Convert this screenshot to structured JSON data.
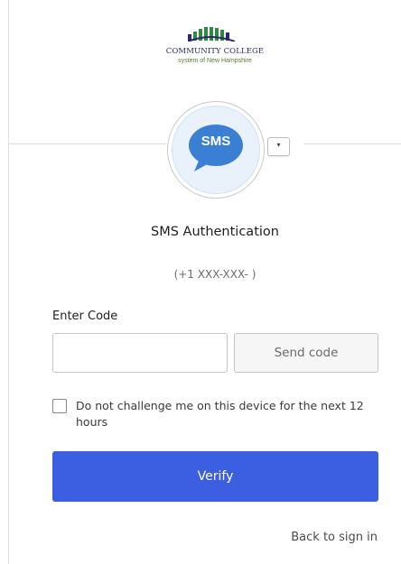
{
  "logo": {
    "name": "COMMUNITY COLLEGE",
    "subtitle": "system of New Hampshire",
    "colors": {
      "arc_top": "#2d8a3e",
      "arc_bottom": "#2a2a6a"
    }
  },
  "factor": {
    "badge_icon": "sms-chat-bubble-icon",
    "badge_text": "SMS",
    "badge_color": "#3a7fd3",
    "dropdown_icon": "caret-down-icon",
    "dropdown_glyph": "▾"
  },
  "title": "SMS Authentication",
  "phone_number": "(+1 XXX-XXX-        )",
  "form": {
    "code_label": "Enter Code",
    "code_value": "",
    "send_code_label": "Send code",
    "remember_checked": false,
    "remember_label": "Do not challenge me on this device for the next 12 hours",
    "verify_label": "Verify",
    "verify_color": "#3c5ee0"
  },
  "footer": {
    "back_link": "Back to sign in"
  }
}
